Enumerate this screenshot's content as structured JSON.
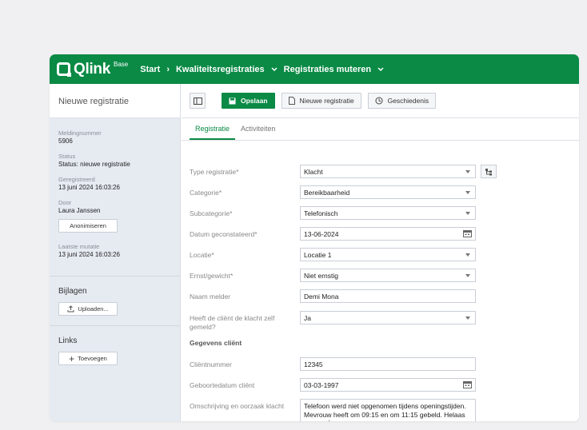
{
  "app": {
    "logo": "Qlink",
    "edition": "Base"
  },
  "breadcrumb": [
    {
      "label": "Start",
      "dropdown": false
    },
    {
      "label": "Kwaliteitsregistraties",
      "dropdown": true
    },
    {
      "label": "Registraties muteren",
      "dropdown": true
    }
  ],
  "sidebar": {
    "title": "Nieuwe registratie",
    "meta": [
      {
        "label": "Meldingnummer",
        "value": "5906"
      },
      {
        "label": "Status",
        "value": "Status: nieuwe registratie"
      },
      {
        "label": "Geregistreerd",
        "value": "13 juni 2024 16:03:26"
      },
      {
        "label": "Door",
        "value": "Laura Janssen"
      },
      {
        "label": "Laatste mutatie",
        "value": "13 juni 2024 16:03:26"
      }
    ],
    "anonymize_label": "Anonimiseren",
    "attachments_title": "Bijlagen",
    "upload_label": "Uploaden...",
    "links_title": "Links",
    "add_label": "Toevoegen"
  },
  "toolbar": {
    "save_label": "Opslaan",
    "new_label": "Nieuwe registratie",
    "history_label": "Geschiedenis"
  },
  "tabs": [
    {
      "label": "Registratie",
      "active": true
    },
    {
      "label": "Activiteiten",
      "active": false
    }
  ],
  "form": {
    "type": {
      "label": "Type registratie*",
      "value": "Klacht"
    },
    "category": {
      "label": "Categorie*",
      "value": "Bereikbaarheid"
    },
    "subcategory": {
      "label": "Subcategorie*",
      "value": "Telefonisch"
    },
    "date_found": {
      "label": "Datum geconstateerd*",
      "value": "13-06-2024"
    },
    "location": {
      "label": "Locatie*",
      "value": "Locatie 1"
    },
    "severity": {
      "label": "Ernst/gewicht*",
      "value": "Niet ernstig"
    },
    "reporter": {
      "label": "Naam melder",
      "value": "Demi Mona"
    },
    "client_reported": {
      "label": "Heeft de cliënt de klacht zelf gemeld?",
      "value": "Ja"
    },
    "client_section": "Gegevens cliënt",
    "client_number": {
      "label": "Cliëntnummer",
      "value": "12345"
    },
    "birthdate": {
      "label": "Geboortedatum cliënt",
      "value": "03-03-1997"
    },
    "description": {
      "label": "Omschrijving en oorzaak klacht",
      "value": "Telefoon werd niet opgenomen tijdens openingstijden. Mevrouw heeft om 09:15 en om 11:15 gebeld. Helaas geen gehoor."
    }
  },
  "colors": {
    "brand": "#0a8a45",
    "sidebar_bg": "#e6ebf2"
  }
}
